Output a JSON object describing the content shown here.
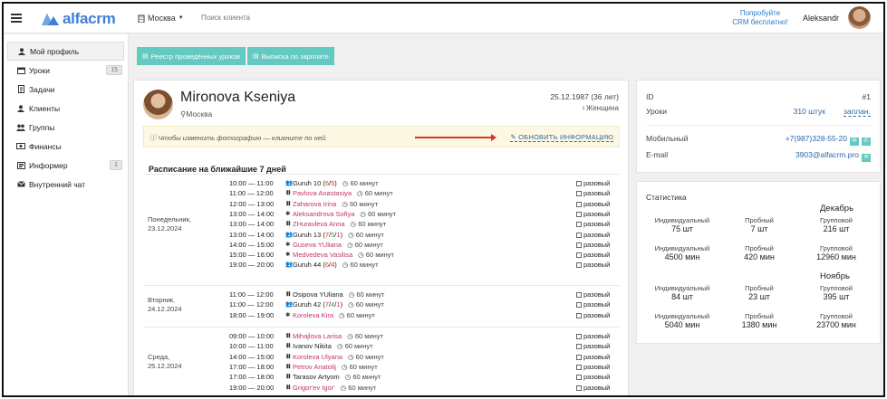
{
  "topbar": {
    "logo": "alfacrm",
    "city": "Москва",
    "search_placeholder": "Поиск клиента",
    "promo_line1": "Попробуйте",
    "promo_line2": "CRM бесплатно!",
    "user_name": "Aleksandr"
  },
  "sidebar": {
    "items": [
      {
        "label": "Мой профиль",
        "icon": "user-icon",
        "active": true
      },
      {
        "label": "Уроки",
        "icon": "calendar-icon",
        "badge": "15"
      },
      {
        "label": "Задачи",
        "icon": "tasks-icon"
      },
      {
        "label": "Клиенты",
        "icon": "clients-icon"
      },
      {
        "label": "Группы",
        "icon": "groups-icon"
      },
      {
        "label": "Финансы",
        "icon": "money-icon"
      },
      {
        "label": "Информер",
        "icon": "informer-icon",
        "badge": "1"
      },
      {
        "label": "Внутренний чат",
        "icon": "chat-icon"
      }
    ]
  },
  "toolbar": {
    "lessons_register": "Реестр проведённых уроков",
    "salary_statement": "Выписка по зарплате"
  },
  "profile": {
    "name": "Mironova Kseniya",
    "city": "Москва",
    "birth": "25.12.1987 (36 лет)",
    "gender": "Женщина",
    "notice": "Чтобы изменить фотографию — кликните по ней.",
    "update_link": "ОБНОВИТЬ ИНФОРМАЦИЮ"
  },
  "schedule": {
    "title": "Расписание на ближайшие 7 дней",
    "once_label": "разовый",
    "days": [
      {
        "line1": "Понедельник,",
        "line2": "23.12.2024",
        "lessons": [
          {
            "time": "10:00 — 11:00",
            "type": "group",
            "name": "Guruh 10 (",
            "c1": "6",
            "c2": "",
            "c3": "5",
            "close": ")",
            "duration": "60 минут"
          },
          {
            "time": "11:00 — 12:00",
            "type": "individual",
            "name": "Pavlova Anastasiya",
            "duration": "60 минут"
          },
          {
            "time": "12:00 — 13:00",
            "type": "individual",
            "name": "Zaharova Irina",
            "duration": "60 минут"
          },
          {
            "time": "13:00 — 14:00",
            "type": "trial",
            "name": "Aleksandrova Sofiya",
            "duration": "60 минут"
          },
          {
            "time": "13:00 — 14:00",
            "type": "individual",
            "name": "ZHuravleva Anna",
            "duration": "60 минут"
          },
          {
            "time": "13:00 — 14:00",
            "type": "group",
            "name": "Guruh 13 (",
            "c1": "7",
            "c2": "5",
            "c3": "1",
            "close": ")",
            "duration": "60 минут"
          },
          {
            "time": "14:00 — 15:00",
            "type": "trial",
            "name": "Guseva YUliana",
            "duration": "60 минут"
          },
          {
            "time": "15:00 — 16:00",
            "type": "trial",
            "name": "Medvedeva Vasilisa",
            "duration": "60 минут"
          },
          {
            "time": "19:00 — 20:00",
            "type": "group",
            "name": "Guruh 44 (",
            "c1": "6",
            "c2": "",
            "c3": "4",
            "close": ")",
            "duration": "60 минут"
          }
        ]
      },
      {
        "line1": "Вторник,",
        "line2": "24.12.2024",
        "lessons": [
          {
            "time": "11:00 — 12:00",
            "type": "individual",
            "name": "Osipova YUliana",
            "duration": "60 минут",
            "plain": true
          },
          {
            "time": "11:00 — 12:00",
            "type": "group",
            "name": "Guruh 42 (",
            "c1": "7",
            "c2": "4",
            "c3": "1",
            "close": ")",
            "duration": "60 минут"
          },
          {
            "time": "18:00 — 19:00",
            "type": "trial",
            "name": "Koroleva Kira",
            "duration": "60 минут"
          }
        ]
      },
      {
        "line1": "Среда,",
        "line2": "25.12.2024",
        "lessons": [
          {
            "time": "09:00 — 10:00",
            "type": "individual",
            "name": "Mihajlova Larisa",
            "duration": "60 минут"
          },
          {
            "time": "10:00 — 11:00",
            "type": "individual",
            "name": "Ivanov Nikita",
            "duration": "60 минут",
            "plain": true
          },
          {
            "time": "14:00 — 15:00",
            "type": "individual",
            "name": "Koroleva Ulyana",
            "duration": "60 минут"
          },
          {
            "time": "17:00 — 18:00",
            "type": "individual",
            "name": "Petrov Anatolij",
            "duration": "60 минут"
          },
          {
            "time": "17:00 — 18:00",
            "type": "individual",
            "name": "Tarasov Artyom",
            "duration": "60 минут",
            "plain": true
          },
          {
            "time": "19:00 — 20:00",
            "type": "individual",
            "name": "Grigor'ev Igor'",
            "duration": "60 минут"
          }
        ]
      }
    ]
  },
  "info": {
    "id_label": "ID",
    "id_value": "#1",
    "lessons_label": "Уроки",
    "lessons_value": "310 штук",
    "lessons_planned": "заплан.",
    "mobile_label": "Мобильный",
    "mobile_value": "+7(987)328-55-20",
    "email_label": "E-mail",
    "email_value": "3903@alfacrm.pro"
  },
  "stats": {
    "title": "Статистика",
    "months": [
      {
        "name": "Декабрь",
        "cells": [
          {
            "label": "Индивидуальный",
            "value": "75 шт"
          },
          {
            "label": "Пробный",
            "value": "7 шт"
          },
          {
            "label": "Групповой",
            "value": "216 шт"
          },
          {
            "label": "Индивидуальный",
            "value": "4500 мин"
          },
          {
            "label": "Пробный",
            "value": "420 мин"
          },
          {
            "label": "Групповой",
            "value": "12960 мин"
          }
        ]
      },
      {
        "name": "Ноябрь",
        "cells": [
          {
            "label": "Индивидуальный",
            "value": "84 шт"
          },
          {
            "label": "Пробный",
            "value": "23 шт"
          },
          {
            "label": "Групповой",
            "value": "395 шт"
          },
          {
            "label": "Индивидуальный",
            "value": "5040 мин"
          },
          {
            "label": "Пробный",
            "value": "1380 мин"
          },
          {
            "label": "Групповой",
            "value": "23700 мин"
          }
        ]
      }
    ]
  },
  "colors": {
    "accent": "#63c9c1",
    "link": "#2b6aa5",
    "student_name": "#c2336b",
    "arrow": "#d9322a"
  }
}
